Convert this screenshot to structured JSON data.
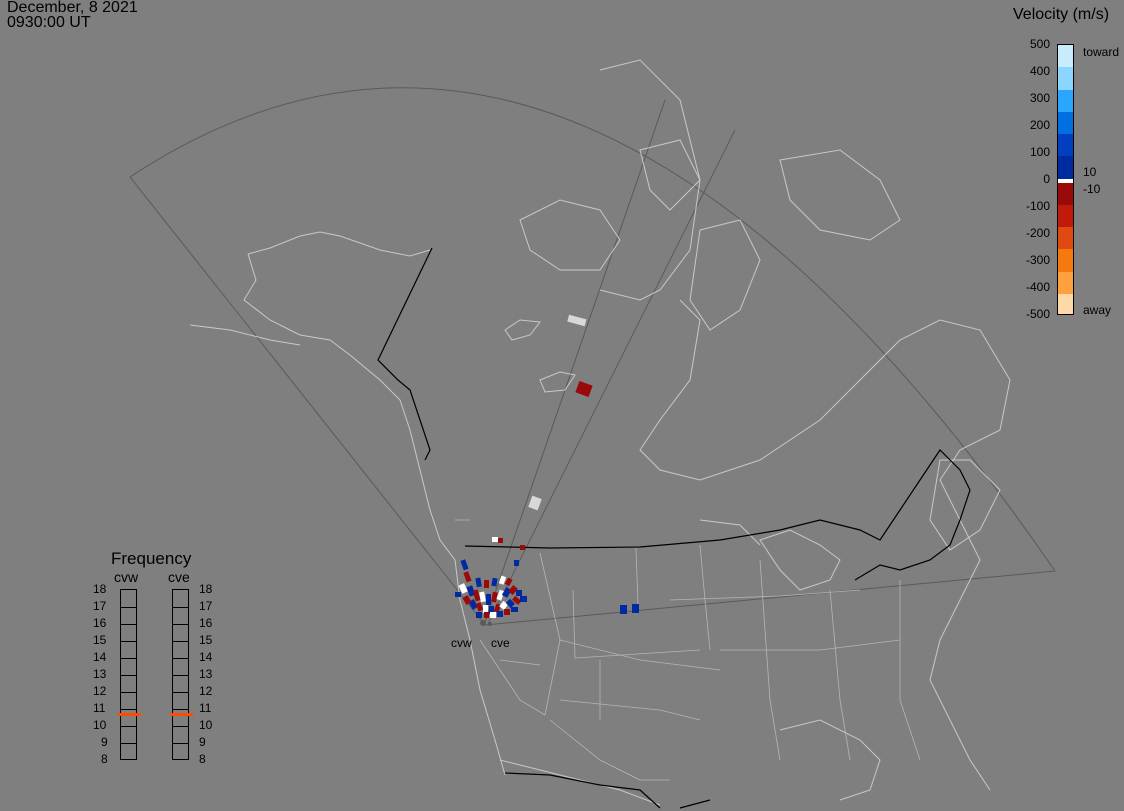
{
  "header": {
    "date": "December, 8 2021",
    "time": "0930:00 UT"
  },
  "velocity_scale": {
    "title": "Velocity (m/s)",
    "ticks": [
      "500",
      "400",
      "300",
      "200",
      "100",
      "0",
      "-100",
      "-200",
      "-300",
      "-400",
      "-500"
    ],
    "toward_label": "toward",
    "away_label": "away",
    "pos_threshold": "10",
    "neg_threshold": "-10",
    "colors": [
      "#c8ecfc",
      "#8ad6ff",
      "#2aa6ff",
      "#0070e0",
      "#0040c0",
      "#002aa0",
      "#ffffff",
      "#9a0a0a",
      "#c21a0a",
      "#e04a10",
      "#f47a10",
      "#ffa040",
      "#ffd8a8"
    ]
  },
  "frequency": {
    "title": "Frequency",
    "levels": [
      "18",
      "17",
      "16",
      "15",
      "14",
      "13",
      "12",
      "11",
      "10",
      "9",
      "8"
    ],
    "radars": [
      {
        "name": "cvw",
        "value": 10.7
      },
      {
        "name": "cve",
        "value": 10.7
      }
    ],
    "marker_color": "#ff4a00"
  },
  "sites": [
    {
      "name": "cvw"
    },
    {
      "name": "cve"
    }
  ]
}
